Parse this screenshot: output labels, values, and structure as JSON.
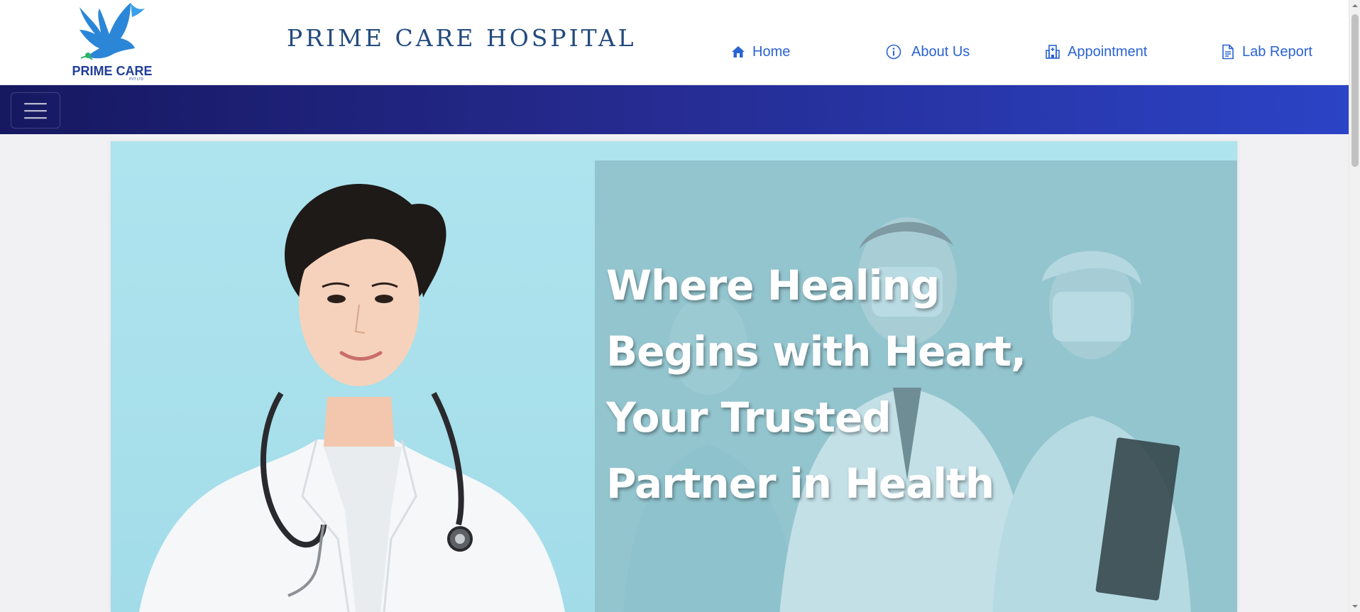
{
  "brand": {
    "logo_text": "PRIME CARE",
    "logo_sub": "PVT LTD",
    "title": "PRIME CARE HOSPITAL"
  },
  "nav": [
    {
      "label": "Home",
      "icon": "home-icon"
    },
    {
      "label": "About Us",
      "icon": "info-icon"
    },
    {
      "label": "Appointment",
      "icon": "hospital-icon"
    },
    {
      "label": "Lab Report",
      "icon": "document-icon"
    }
  ],
  "toggler": {
    "icon": "hamburger-icon"
  },
  "hero": {
    "heading": "Where Healing Begins with Heart, Your Trusted Partner in Health"
  },
  "colors": {
    "nav_link": "#2a63d2",
    "title": "#234a7e",
    "bar_start": "#161860",
    "bar_end": "#2b43c6",
    "hero_bg": "#aee4ee"
  }
}
